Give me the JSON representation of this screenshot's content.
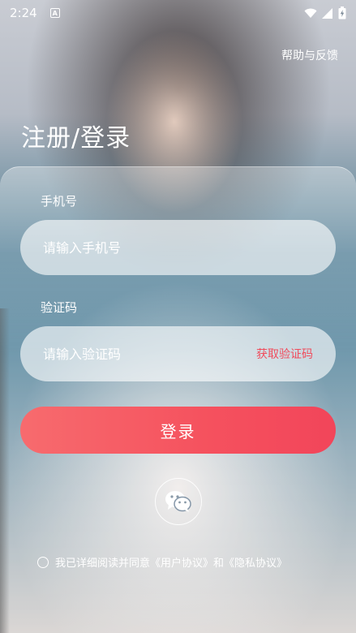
{
  "status_bar": {
    "time": "2:24",
    "notification_icon": "a-badge-icon",
    "icons": [
      "wifi-icon",
      "signal-icon",
      "battery-charging-icon"
    ]
  },
  "header": {
    "help_link": "帮助与反馈",
    "title": "注册/登录"
  },
  "form": {
    "phone_label": "手机号",
    "phone_placeholder": "请输入手机号",
    "code_label": "验证码",
    "code_placeholder": "请输入验证码",
    "get_code_button": "获取验证码",
    "login_button": "登录"
  },
  "social": {
    "wechat_icon": "wechat-icon"
  },
  "agreement": {
    "prefix": "我已详细阅读并同意",
    "user_agreement": "《用户协议》",
    "conjunction": "和",
    "privacy_policy": "《隐私协议》",
    "checked": false
  },
  "colors": {
    "accent": "#f5515e",
    "get_code_text": "#f04c5c"
  }
}
